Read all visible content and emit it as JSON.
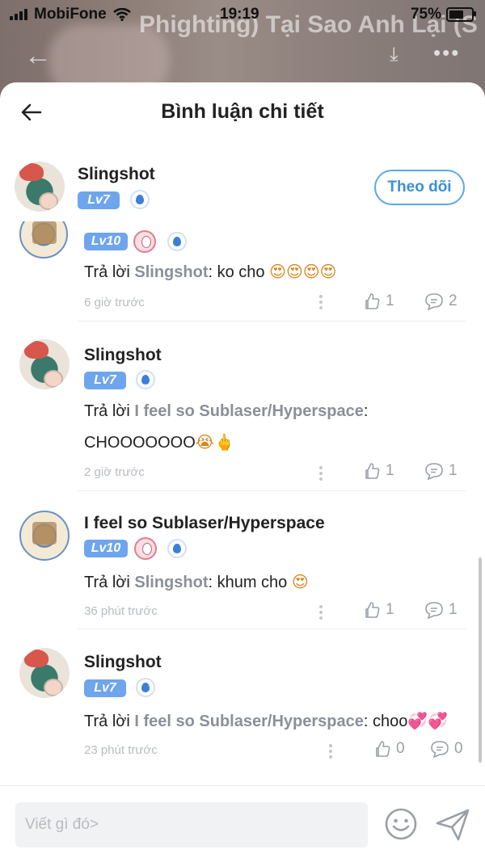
{
  "status_bar": {
    "carrier": "MobiFone",
    "time": "19:19",
    "battery": "75%",
    "battery_level": 0.75
  },
  "background": {
    "title": "Phighting) Tại Sao Anh Lại (Sub Space X Medki..."
  },
  "header": {
    "title": "Bình luận chi tiết",
    "back_icon": "arrow-left-icon"
  },
  "author": {
    "name": "Slingshot",
    "level": "Lv7",
    "follow_label": "Theo dõi"
  },
  "comments": [
    {
      "level": "Lv10",
      "reply_prefix": "Trả lời ",
      "reply_to": "Slingshot",
      "text": ": ko cho ",
      "emoji": "😍😍😍😍",
      "time": "6 giờ trước",
      "likes": "1",
      "replies": "2"
    },
    {
      "name": "Slingshot",
      "level": "Lv7",
      "reply_prefix": "Trả lời ",
      "reply_to": "I feel so Sublaser/Hyperspace",
      "text": ":",
      "text_line2": "CHOOOOOOO",
      "emoji": "😭🖕",
      "time": "2 giờ trước",
      "likes": "1",
      "replies": "1"
    },
    {
      "name": "I feel so Sublaser/Hyperspace",
      "level": "Lv10",
      "reply_prefix": "Trả lời ",
      "reply_to": "Slingshot",
      "text": ": khum cho ",
      "emoji": "😍",
      "time": "36 phút trước",
      "likes": "1",
      "replies": "1"
    },
    {
      "name": "Slingshot",
      "level": "Lv7",
      "reply_prefix": "Trả lời ",
      "reply_to": "I feel so Sublaser/Hyperspace",
      "text": ": choo",
      "emoji": "💞💞",
      "time": "23 phút trước",
      "likes": "0",
      "replies": "0"
    }
  ],
  "input": {
    "placeholder": "Viết gì đó>"
  },
  "colors": {
    "accent": "#5ba8e6",
    "level_badge": "#6ea5ec",
    "muted": "#9aa0a8"
  }
}
